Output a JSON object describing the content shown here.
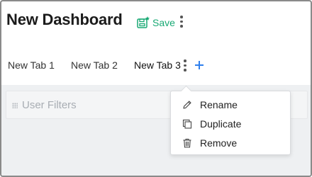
{
  "header": {
    "title": "New Dashboard",
    "save_label": "Save",
    "save_icon": "save-disk-icon"
  },
  "tabs": [
    {
      "label": "New Tab 1",
      "active": false
    },
    {
      "label": "New Tab 2",
      "active": false
    },
    {
      "label": "New Tab 3",
      "active": true
    }
  ],
  "add_tab_icon": "plus-icon",
  "filters": {
    "label": "User Filters",
    "icon": "grip-icon"
  },
  "tab_menu": {
    "items": [
      {
        "label": "Rename",
        "icon": "pencil-icon"
      },
      {
        "label": "Duplicate",
        "icon": "duplicate-icon"
      },
      {
        "label": "Remove",
        "icon": "trash-icon"
      }
    ]
  },
  "colors": {
    "save_green": "#19a974",
    "add_blue": "#2f80ed",
    "placeholder_grey": "#a8adb3",
    "background_grey": "#eef0f2"
  }
}
